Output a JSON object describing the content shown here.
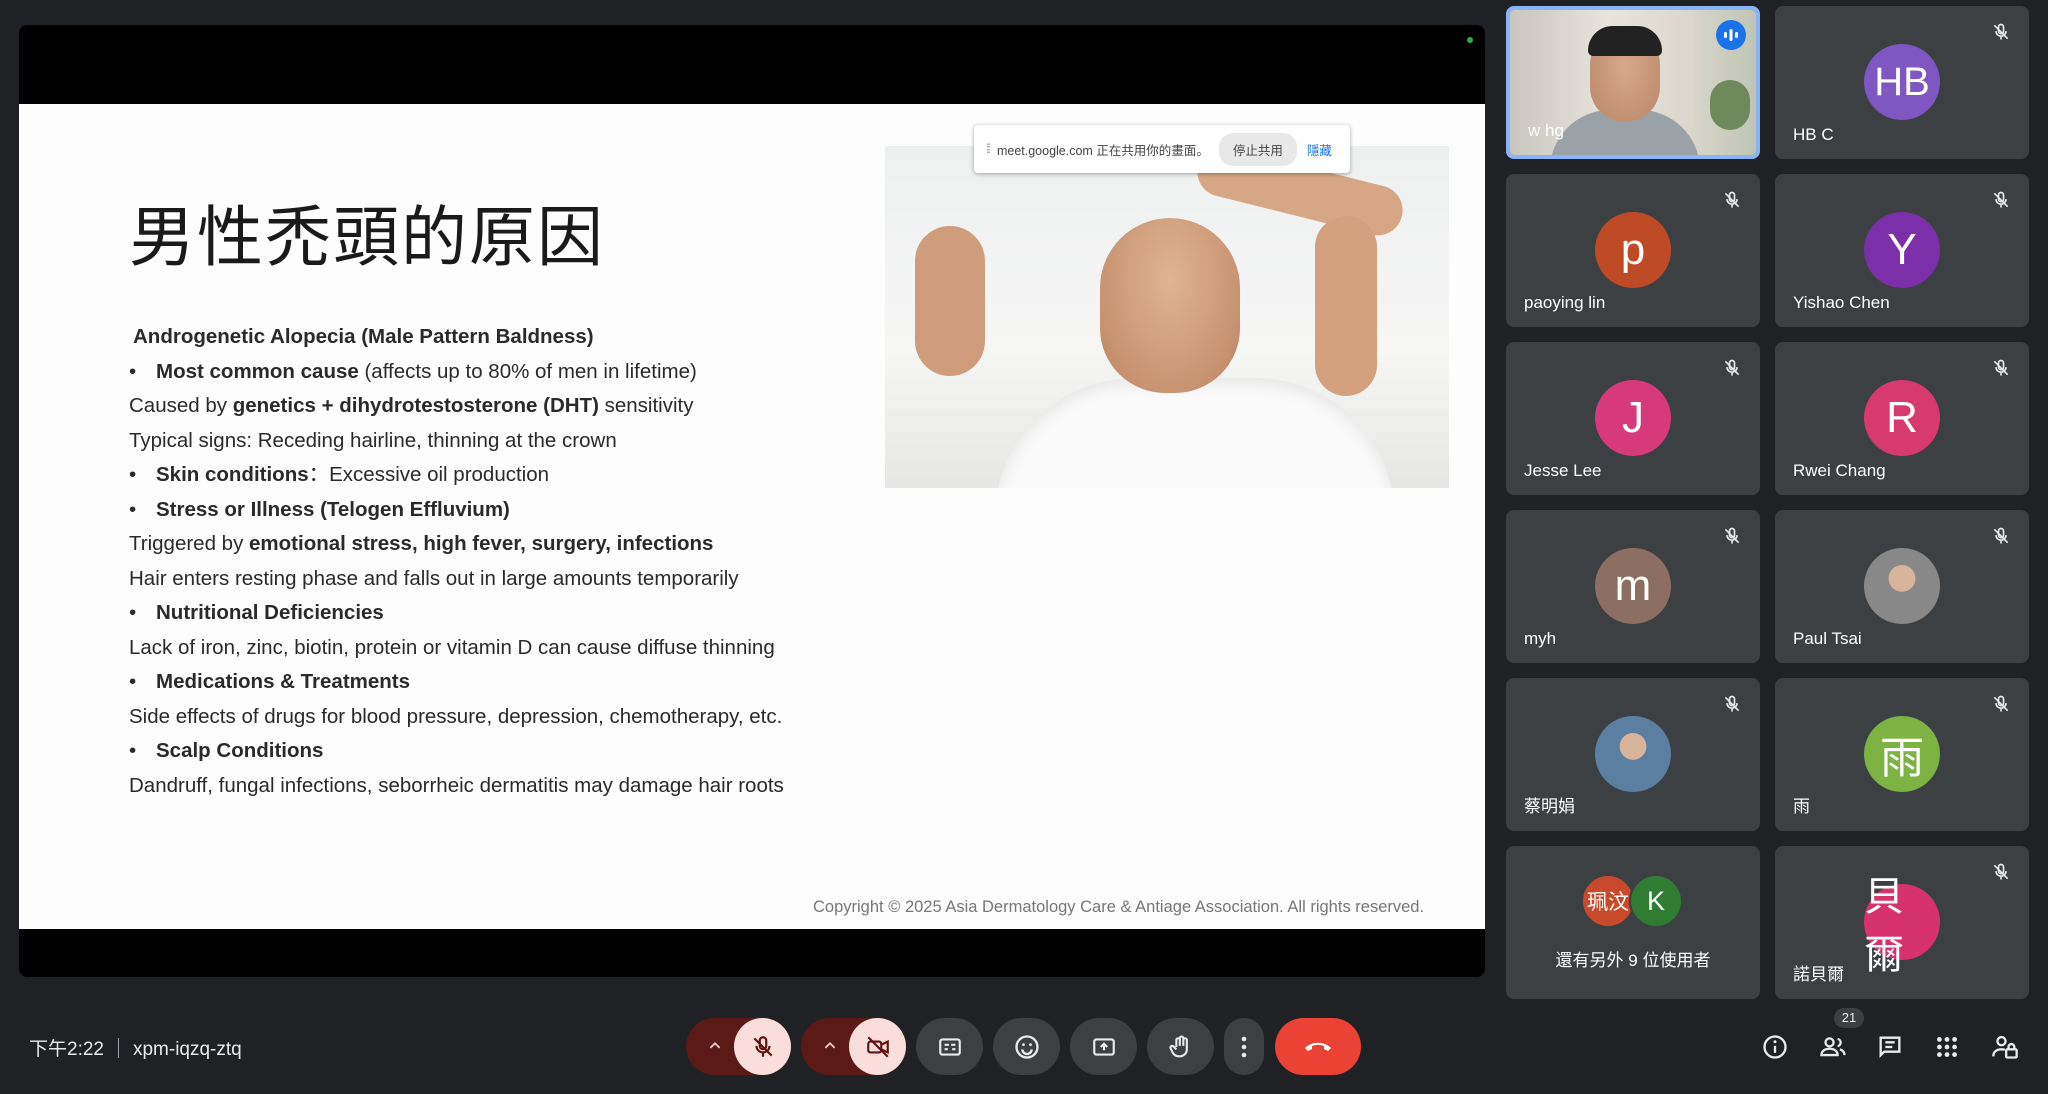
{
  "presentation": {
    "title": "男性禿頭的原因",
    "lines": [
      {
        "kind": "head",
        "parts": [
          {
            "b": true,
            "t": "Androgenetic Alopecia (Male Pattern Baldness)"
          }
        ]
      },
      {
        "kind": "bullet",
        "parts": [
          {
            "b": true,
            "t": "Most common cause"
          },
          {
            "b": false,
            "t": " (affects up to 80% of men in lifetime)"
          }
        ]
      },
      {
        "kind": "text",
        "parts": [
          {
            "b": false,
            "t": "Caused by "
          },
          {
            "b": true,
            "t": "genetics + dihydrotestosterone (DHT)"
          },
          {
            "b": false,
            "t": " sensitivity"
          }
        ]
      },
      {
        "kind": "text",
        "parts": [
          {
            "b": false,
            "t": "Typical signs: Receding hairline, thinning at the crown"
          }
        ]
      },
      {
        "kind": "bullet",
        "parts": [
          {
            "b": true,
            "t": "Skin conditions"
          },
          {
            "b": false,
            "t": "：Excessive oil production"
          }
        ]
      },
      {
        "kind": "bullet",
        "parts": [
          {
            "b": true,
            "t": "Stress or Illness (Telogen Effluvium)"
          }
        ]
      },
      {
        "kind": "text",
        "parts": [
          {
            "b": false,
            "t": "Triggered by "
          },
          {
            "b": true,
            "t": "emotional stress, high fever, surgery, infections"
          }
        ]
      },
      {
        "kind": "text",
        "parts": [
          {
            "b": false,
            "t": "Hair enters resting phase and falls out in large amounts temporarily"
          }
        ]
      },
      {
        "kind": "bullet",
        "parts": [
          {
            "b": true,
            "t": "Nutritional Deficiencies"
          }
        ]
      },
      {
        "kind": "text",
        "parts": [
          {
            "b": false,
            "t": "Lack of iron, zinc, biotin, protein or vitamin D can cause diffuse thinning"
          }
        ]
      },
      {
        "kind": "bullet",
        "parts": [
          {
            "b": true,
            "t": "Medications & Treatments"
          }
        ]
      },
      {
        "kind": "text",
        "parts": [
          {
            "b": false,
            "t": "Side effects of drugs for blood pressure, depression, chemotherapy, etc."
          }
        ]
      },
      {
        "kind": "bullet",
        "parts": [
          {
            "b": true,
            "t": "Scalp Conditions"
          }
        ]
      },
      {
        "kind": "text",
        "parts": [
          {
            "b": false,
            "t": "Dandruff, fungal infections, seborrheic dermatitis may damage hair roots"
          }
        ]
      }
    ],
    "copyright": "Copyright © 2025 Asia Dermatology Care & Antiage Association.  All rights reserved."
  },
  "share_bar": {
    "message": "meet.google.com 正在共用你的畫面。",
    "stop_label": "停止共用",
    "hide_label": "隱藏"
  },
  "participants": {
    "speaker": {
      "name": "w hg"
    },
    "tiles": [
      {
        "name": "HB C",
        "initials": "HB",
        "color": "#7e57c2"
      },
      {
        "name": "paoying lin",
        "initials": "p",
        "color": "#bf4a26"
      },
      {
        "name": "Yishao Chen",
        "initials": "Y",
        "color": "#7b2fa8"
      },
      {
        "name": "Jesse Lee",
        "initials": "J",
        "color": "#d63a7a"
      },
      {
        "name": "Rwei Chang",
        "initials": "R",
        "color": "#d63a6e"
      },
      {
        "name": "myh",
        "initials": "m",
        "color": "#8d6e63"
      },
      {
        "name": "Paul Tsai",
        "initials": "",
        "color": "#888888"
      },
      {
        "name": "蔡明娟",
        "initials": "",
        "color": "#5a7fa0"
      },
      {
        "name": "雨",
        "initials": "雨",
        "color": "#7cb342"
      },
      {
        "name": "諾貝爾",
        "initials": "貝爾",
        "color": "#d6336c"
      }
    ],
    "more": {
      "label": "還有另外 9 位使用者",
      "avatar1": "珮汶",
      "avatar2": "K"
    }
  },
  "meeting": {
    "time": "下午2:22",
    "code": "xpm-iqzq-ztq",
    "participant_count": "21"
  },
  "icons": {
    "mic_off": "mic-off-icon",
    "camera_off": "camera-off-icon",
    "captions": "captions-icon",
    "emoji": "emoji-icon",
    "present": "present-icon",
    "hand": "raise-hand-icon",
    "more": "more-vert-icon",
    "end_call": "end-call-icon",
    "info": "info-icon",
    "people": "people-icon",
    "chat": "chat-icon",
    "activities": "apps-icon",
    "host_controls": "lock-person-icon"
  }
}
